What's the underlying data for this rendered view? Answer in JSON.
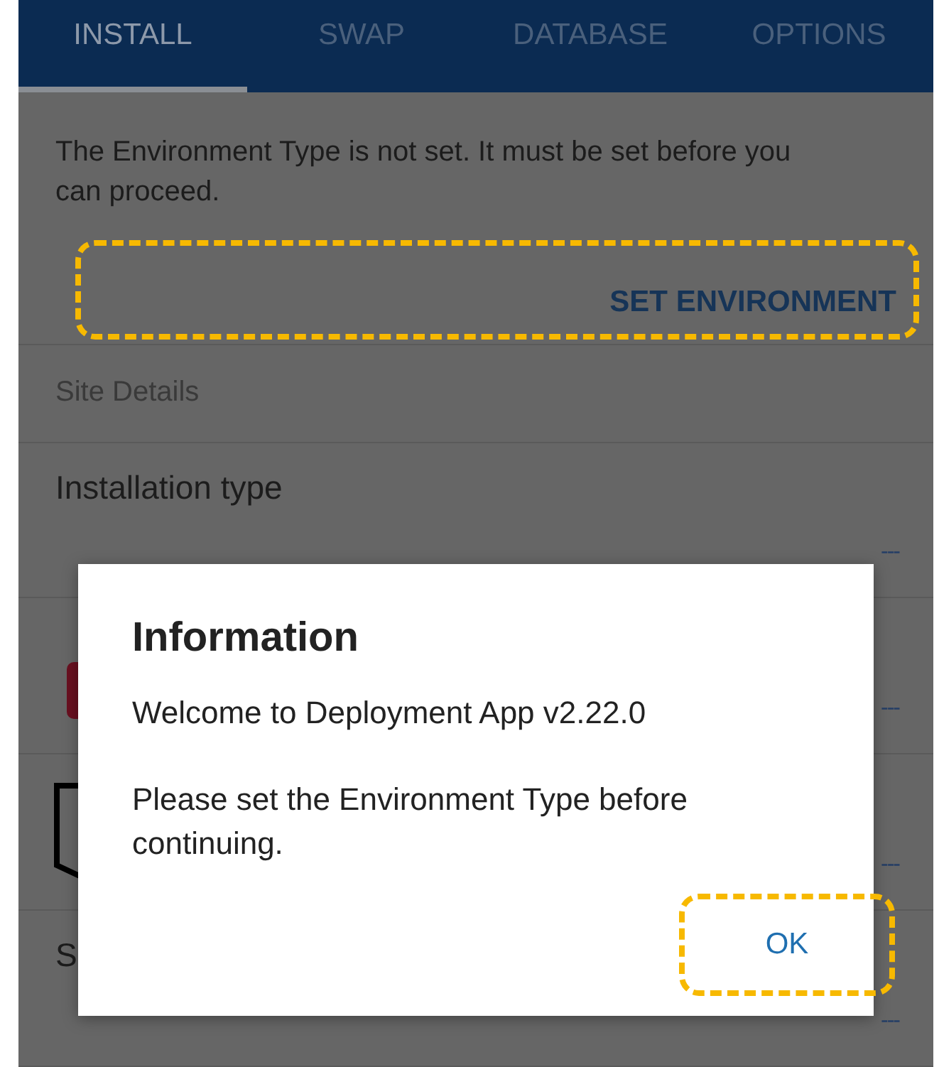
{
  "tabs": [
    {
      "label": "INSTALL",
      "selected": true
    },
    {
      "label": "SWAP",
      "selected": false
    },
    {
      "label": "DATABASE",
      "selected": false
    },
    {
      "label": "OPTIONS",
      "selected": false
    }
  ],
  "notice": {
    "message": "The Environment Type is not set. It must be set before you can proceed.",
    "action": "SET ENVIRONMENT"
  },
  "section_header": "Site Details",
  "rows": [
    {
      "kind": "text",
      "label": "Installation type",
      "value": "---"
    },
    {
      "kind": "badge",
      "value": "---"
    },
    {
      "kind": "frame",
      "value": "---"
    },
    {
      "kind": "text",
      "label": "S",
      "value": "---"
    }
  ],
  "dialog": {
    "title": "Information",
    "lines": [
      "Welcome to Deployment App v2.22.0",
      "Please set the Environment Type before continuing."
    ],
    "button": "OK"
  }
}
